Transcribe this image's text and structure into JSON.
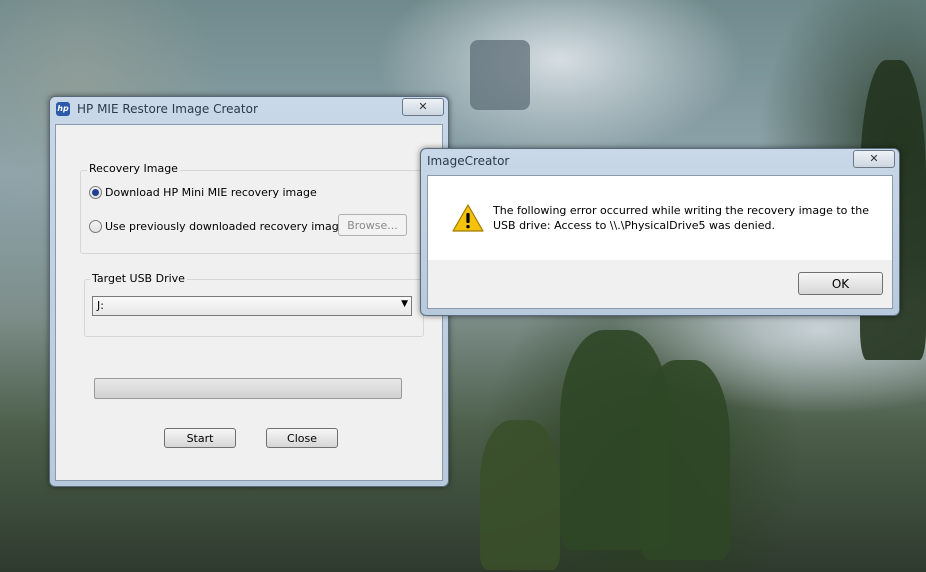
{
  "main_window": {
    "title": "HP MIE Restore Image Creator",
    "close_label": "✕",
    "recovery_group_label": "Recovery Image",
    "option_download_label": "Download HP Mini MIE recovery image",
    "option_previous_label": "Use previously downloaded recovery image",
    "selected_option": "download",
    "browse_label": "Browse...",
    "usb_group_label": "Target USB Drive",
    "usb_drive_value": "J:",
    "progress": 0,
    "start_label": "Start",
    "close_button_label": "Close"
  },
  "error_dialog": {
    "title": "ImageCreator",
    "close_label": "✕",
    "message_line1": "The following error occurred while writing the recovery image to the",
    "message_line2": "USB drive: Access to \\\\.\\PhysicalDrive5 was denied.",
    "ok_label": "OK"
  },
  "icons": {
    "app_icon": "hp-logo-icon",
    "warning_icon": "warning-icon",
    "dropdown_icon": "chevron-down-icon"
  },
  "colors": {
    "warning": "#f4c20d",
    "progress_fill": "#3cbf3c"
  }
}
